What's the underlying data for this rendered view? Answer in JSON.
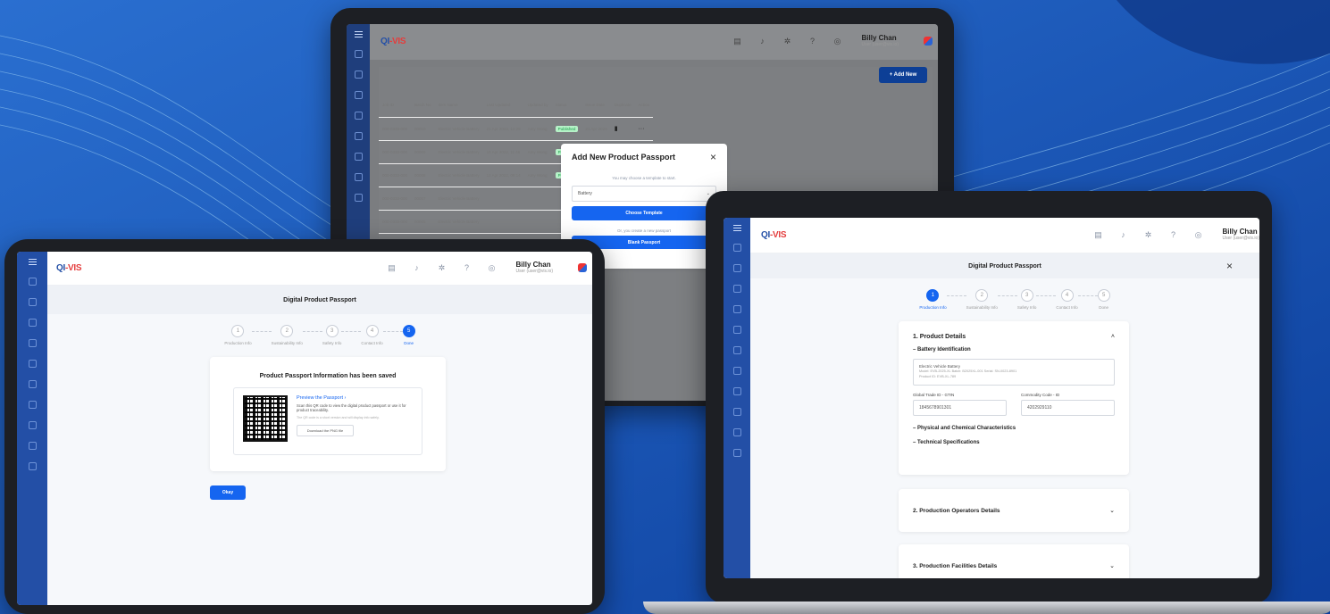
{
  "brand": {
    "logo_main": "QI",
    "logo_accent": "-VIS"
  },
  "user": {
    "name": "Billy Chan",
    "role": "User (user@vis.io)"
  },
  "top_icons": [
    "chat-icon",
    "bell-icon",
    "gear-icon",
    "help-icon",
    "globe-icon"
  ],
  "list_screen": {
    "add_button": "+ Add New",
    "columns": [
      "Job ID",
      "Batch No",
      "Item Name",
      "Last Updated",
      "Updated by",
      "Status",
      "Issue Date",
      "Duplicate",
      "Action"
    ],
    "rows": [
      {
        "job": "000-0333-000",
        "batch": "00010",
        "item": "Electric Vehicle Battery",
        "updated": "21 Apr 2024, 12:29",
        "by": "Amy Wong",
        "status": "Published",
        "issue": "21 Apr 2024"
      },
      {
        "job": "000-0333-000",
        "batch": "00009",
        "item": "Electric Vehicle Battery",
        "updated": "16 Apr 2022, 11:46",
        "by": "Amy Wong",
        "status": "Published",
        "issue": "16 Apr 2022"
      },
      {
        "job": "000-0333-000",
        "batch": "00008",
        "item": "Electric Vehicle Battery",
        "updated": "12 Apr 2022, 09:14",
        "by": "Amy Wong",
        "status": "Published",
        "issue": "12 Apr 2022"
      },
      {
        "job": "000-0333-000",
        "batch": "00007",
        "item": "Electric Vehicle Battery",
        "updated": "",
        "by": "",
        "status": "",
        "issue": ""
      },
      {
        "job": "000-0333-000",
        "batch": "00005",
        "item": "Electric Vehicle Battery",
        "updated": "",
        "by": "",
        "status": "",
        "issue": ""
      }
    ],
    "modal": {
      "title": "Add New Product Passport",
      "hint": "You may choose a template to start.",
      "select_value": "Battery",
      "choose_button": "Choose Template",
      "or_text": "Or, you create a new passport",
      "blank_button": "Blank Passport"
    }
  },
  "passport": {
    "title": "Digital Product Passport",
    "steps": [
      {
        "num": "1",
        "label": "Production Info"
      },
      {
        "num": "2",
        "label": "Sustainability Info"
      },
      {
        "num": "3",
        "label": "Safety Info"
      },
      {
        "num": "4",
        "label": "Contact Info"
      },
      {
        "num": "5",
        "label": "Done"
      }
    ]
  },
  "saved_screen": {
    "heading": "Product Passport Information has been saved",
    "preview_link": "Preview the Passport ›",
    "desc": "Scan this QR code to view the digital product passport or use it for product traceability.",
    "note": "The QR code is a short version and will display info safely.",
    "download": "Download the PNG file",
    "okay": "Okay"
  },
  "details_screen": {
    "section1": "1. Product Details",
    "battery_id": "Battery Identification",
    "product_name": "Electric Vehicle Battery",
    "product_meta": "Model: EVB-2025-XL  Batch: B2025XL-001  Serial: SN-0023-8901\nProduct ID: EVB-XL-789",
    "gtin_label": "Global Trade ID - GTIN",
    "gtin_value": "1845678901301",
    "commodity_label": "Commodity Code - ID",
    "commodity_value": "4202929110",
    "physical": "Physical and Chemical Characteristics",
    "technical": "Technical Specifications",
    "section2": "2. Production Operators Details",
    "section3": "3. Production Facilities Details"
  }
}
